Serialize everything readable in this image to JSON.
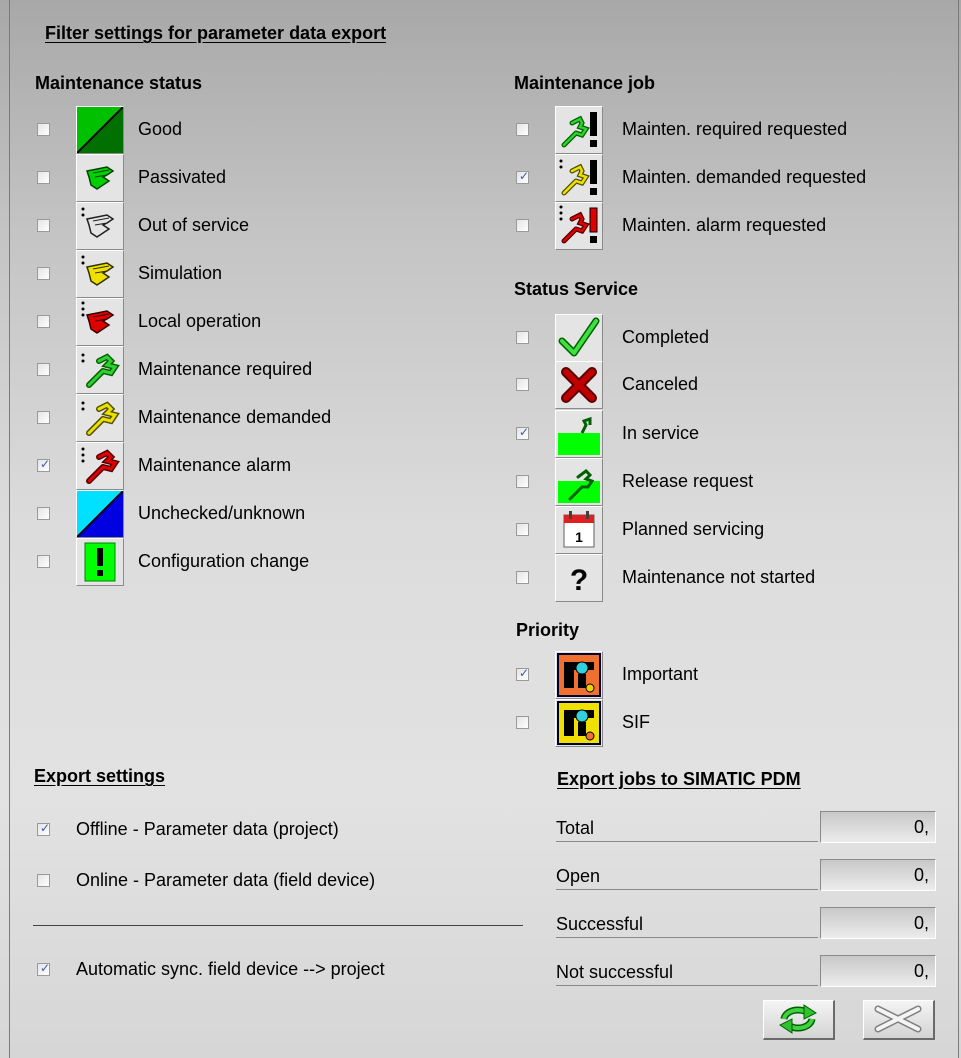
{
  "title": "Filter settings for parameter data export",
  "maintenance_status": {
    "heading": "Maintenance status",
    "items": [
      {
        "label": "Good",
        "checked": false,
        "icon": "good-icon"
      },
      {
        "label": "Passivated",
        "checked": false,
        "icon": "passivated-hand-icon"
      },
      {
        "label": "Out of service",
        "checked": false,
        "icon": "out-of-service-hand-icon"
      },
      {
        "label": "Simulation",
        "checked": false,
        "icon": "simulation-hand-icon"
      },
      {
        "label": "Local operation",
        "checked": false,
        "icon": "local-operation-hand-icon"
      },
      {
        "label": "Maintenance required",
        "checked": false,
        "icon": "wrench-green-icon"
      },
      {
        "label": "Maintenance demanded",
        "checked": false,
        "icon": "wrench-yellow-icon"
      },
      {
        "label": "Maintenance alarm",
        "checked": true,
        "icon": "wrench-red-icon"
      },
      {
        "label": "Unchecked/unknown",
        "checked": false,
        "icon": "unchecked-unknown-icon"
      },
      {
        "label": "Configuration change",
        "checked": false,
        "icon": "configuration-change-icon"
      }
    ]
  },
  "maintenance_job": {
    "heading": "Maintenance job",
    "items": [
      {
        "label": "Mainten. required requested",
        "checked": false,
        "icon": "wrench-green-exclamation-icon"
      },
      {
        "label": "Mainten. demanded requested",
        "checked": true,
        "icon": "wrench-yellow-exclamation-icon"
      },
      {
        "label": "Mainten. alarm requested",
        "checked": false,
        "icon": "wrench-red-exclamation-icon"
      }
    ]
  },
  "status_service": {
    "heading": "Status Service",
    "items": [
      {
        "label": "Completed",
        "checked": false,
        "icon": "checkmark-icon"
      },
      {
        "label": "Canceled",
        "checked": false,
        "icon": "cross-icon"
      },
      {
        "label": "In service",
        "checked": true,
        "icon": "in-service-icon"
      },
      {
        "label": "Release request",
        "checked": false,
        "icon": "release-request-icon"
      },
      {
        "label": "Planned servicing",
        "checked": false,
        "icon": "calendar-icon"
      },
      {
        "label": "Maintenance not started",
        "checked": false,
        "icon": "question-mark-icon"
      }
    ]
  },
  "priority": {
    "heading": "Priority",
    "items": [
      {
        "label": "Important",
        "checked": true,
        "icon": "priority-important-icon"
      },
      {
        "label": "SIF",
        "checked": false,
        "icon": "priority-sif-icon"
      }
    ]
  },
  "export_settings": {
    "heading": "Export settings",
    "items": [
      {
        "label": "Offline - Parameter data (project)",
        "checked": true
      },
      {
        "label": "Online - Parameter data (field device)",
        "checked": false
      }
    ],
    "auto_sync": {
      "label": "Automatic sync. field device --> project",
      "checked": true
    }
  },
  "export_jobs": {
    "heading": "Export jobs to SIMATIC PDM",
    "counters": [
      {
        "label": "Total",
        "value": "0,"
      },
      {
        "label": "Open",
        "value": "0,"
      },
      {
        "label": "Successful",
        "value": "0,"
      },
      {
        "label": "Not successful",
        "value": "0,"
      }
    ]
  },
  "buttons": {
    "refresh_icon": "refresh-arrows-icon",
    "close_icon": "close-x-icon"
  },
  "colors": {
    "good_green": "#00c000",
    "alarm_red": "#e00000",
    "demanded_yellow": "#f0e000",
    "unknown_cyan": "#00e0ff",
    "config_green": "#00ff00",
    "priority_orange": "#f07030",
    "priority_yellow": "#f0e000"
  }
}
